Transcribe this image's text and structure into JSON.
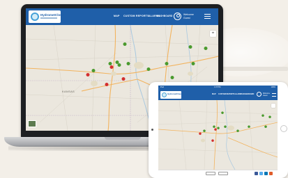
{
  "laptop_app": {
    "logo": {
      "name": "HydrometCloud"
    },
    "nav": [
      "MAP",
      "CUSTOM REPORTS",
      "ALARMS",
      "DASHBOARD"
    ],
    "user": {
      "greeting": "Welcome",
      "name": "Guest"
    },
    "map": {
      "region_label": "KANSAS",
      "control_icon": "location-icon"
    }
  },
  "tablet_app": {
    "status": {
      "carrier": "iPad",
      "time": "1:07 PM",
      "battery": "100%"
    },
    "logo": {
      "name": "HydrometCloud"
    },
    "nav": [
      "MAP",
      "CUSTOM REPORTS",
      "ALARMS",
      "DASHBOARD"
    ],
    "user": {
      "greeting": "Welcome",
      "name": "Guest"
    }
  },
  "colors": {
    "header_blue": "#1f5fa9",
    "marker_green": "#4a9a2e",
    "marker_red": "#d32f2f",
    "highway_orange": "#f2b35e",
    "map_background": "#ebe7de"
  }
}
